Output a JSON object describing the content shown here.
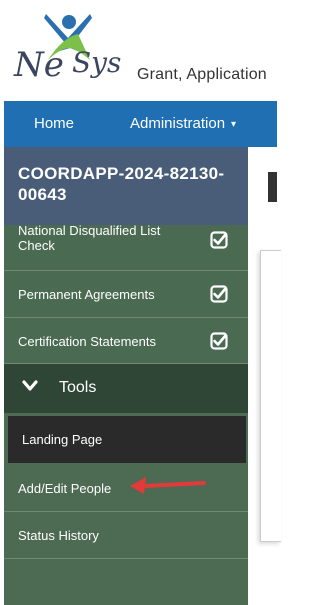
{
  "header": {
    "tagline": "Grant, Application"
  },
  "nav": {
    "home": "Home",
    "administration": "Administration",
    "caret": "▾"
  },
  "sidebar": {
    "application_id": "COORDAPP-2024-82130-00643",
    "checked_items": [
      {
        "label": "National Disqualified List Check",
        "status": "checked"
      },
      {
        "label": "Permanent Agreements",
        "status": "checked"
      },
      {
        "label": "Certification Statements",
        "status": "checked"
      }
    ],
    "tools_label": "Tools",
    "tools_items": [
      {
        "label": "Landing Page",
        "active": true
      },
      {
        "label": "Add/Edit People"
      },
      {
        "label": "Status History"
      }
    ]
  },
  "icons": {
    "checkbox": "checkbox-checked-icon",
    "chevron": "chevron-down-icon",
    "pointer": "red-arrow-pointer"
  },
  "colors": {
    "nav_bg": "#1f6fb2",
    "sidebar_header": "#4a5d78",
    "sidebar_bg": "#4a6a51",
    "tools_bg": "#2f4535",
    "active_item": "#2a2a2a",
    "arrow": "#e23a3a"
  }
}
